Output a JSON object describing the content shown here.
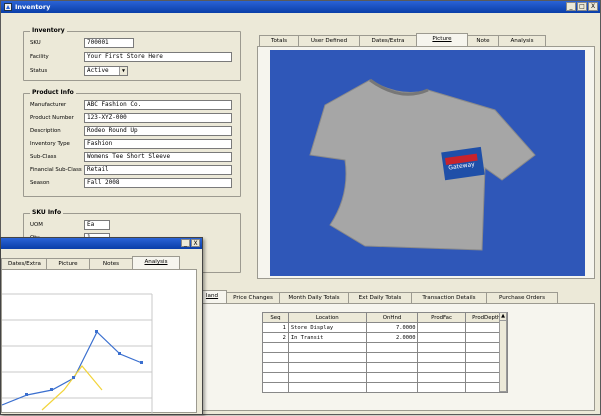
{
  "window": {
    "title": "Inventory",
    "minimize": "_",
    "restore": "□",
    "close": "X"
  },
  "inventory": {
    "legend": "Inventory",
    "sku_label": "SKU",
    "sku_value": "700001",
    "facility_label": "Facility",
    "facility_value": "Your First Store Here",
    "status_label": "Status",
    "status_value": "Active"
  },
  "product_info": {
    "legend": "Product Info",
    "fields": [
      {
        "label": "Manufacturer",
        "value": "ABC Fashion Co."
      },
      {
        "label": "Product Number",
        "value": "123-XYZ-000"
      },
      {
        "label": "Description",
        "value": "Rodeo Round Up"
      },
      {
        "label": "Inventory Type",
        "value": "Fashion"
      },
      {
        "label": "Sub-Class",
        "value": "Womens Tee Short Sleeve"
      },
      {
        "label": "Financial Sub-Class",
        "value": "Retail"
      },
      {
        "label": "Season",
        "value": "Fall 2008"
      }
    ]
  },
  "sku_info": {
    "legend": "SKU Info",
    "uom_label": "UOM",
    "uom_value": "Ea",
    "qty_label": "Qty",
    "qty_value": "1"
  },
  "top_tabs": [
    {
      "label": "Totals"
    },
    {
      "label": "User Defined"
    },
    {
      "label": "Dates/Extra"
    },
    {
      "label": "Picture"
    },
    {
      "label": "Note"
    },
    {
      "label": "Analysis"
    }
  ],
  "picture": {
    "bg_color": "#2f57b8",
    "shirt_color": "#a6a6a6",
    "shirt_logo": "Gateway"
  },
  "bottom_tabs": [
    {
      "label": "Iand"
    },
    {
      "label": "Price Changes"
    },
    {
      "label": "Month Daily Totals"
    },
    {
      "label": "Ext Daily Totals"
    },
    {
      "label": "Transaction Details"
    },
    {
      "label": "Purchase Orders"
    }
  ],
  "locations_grid": {
    "columns": [
      "Seq",
      "Location",
      "OnHnd",
      "ProdFac",
      "ProdDepth"
    ],
    "rows": [
      {
        "seq": "1",
        "location": "Store Display",
        "onhnd": "7.0000",
        "prodfac": "",
        "proddepth": ""
      },
      {
        "seq": "2",
        "location": "In Transit",
        "onhnd": "2.0000",
        "prodfac": "",
        "proddepth": ""
      }
    ]
  },
  "analysis_window": {
    "tabs": [
      {
        "label": "Dates/Extra"
      },
      {
        "label": "Picture"
      },
      {
        "label": "Notes"
      },
      {
        "label": "Analysis"
      }
    ],
    "minimize": "_",
    "close": "X"
  }
}
